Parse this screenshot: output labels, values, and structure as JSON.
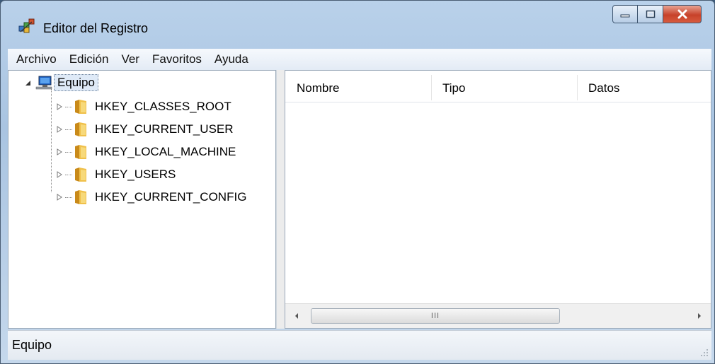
{
  "window": {
    "title": "Editor del Registro",
    "icon": "registry-editor-icon",
    "controls": [
      "minimize-icon",
      "maximize-icon",
      "close-icon"
    ]
  },
  "menu": {
    "items": [
      {
        "label": "Archivo"
      },
      {
        "label": "Edición"
      },
      {
        "label": "Ver"
      },
      {
        "label": "Favoritos"
      },
      {
        "label": "Ayuda"
      }
    ]
  },
  "tree": {
    "root": {
      "label": "Equipo",
      "icon": "computer-icon"
    },
    "keys": [
      {
        "label": "HKEY_CLASSES_ROOT",
        "icon": "folder-icon"
      },
      {
        "label": "HKEY_CURRENT_USER",
        "icon": "folder-icon"
      },
      {
        "label": "HKEY_LOCAL_MACHINE",
        "icon": "folder-icon"
      },
      {
        "label": "HKEY_USERS",
        "icon": "folder-icon"
      },
      {
        "label": "HKEY_CURRENT_CONFIG",
        "icon": "folder-icon"
      }
    ]
  },
  "list": {
    "columns": [
      {
        "label": "Nombre"
      },
      {
        "label": "Tipo"
      },
      {
        "label": "Datos"
      }
    ],
    "scroll_thumb_glyph": "III"
  },
  "status": {
    "text": "Equipo"
  },
  "colors": {
    "title_bar": "#b9d1ea",
    "close_button": "#c7422a",
    "folder": "#e8b73a"
  }
}
